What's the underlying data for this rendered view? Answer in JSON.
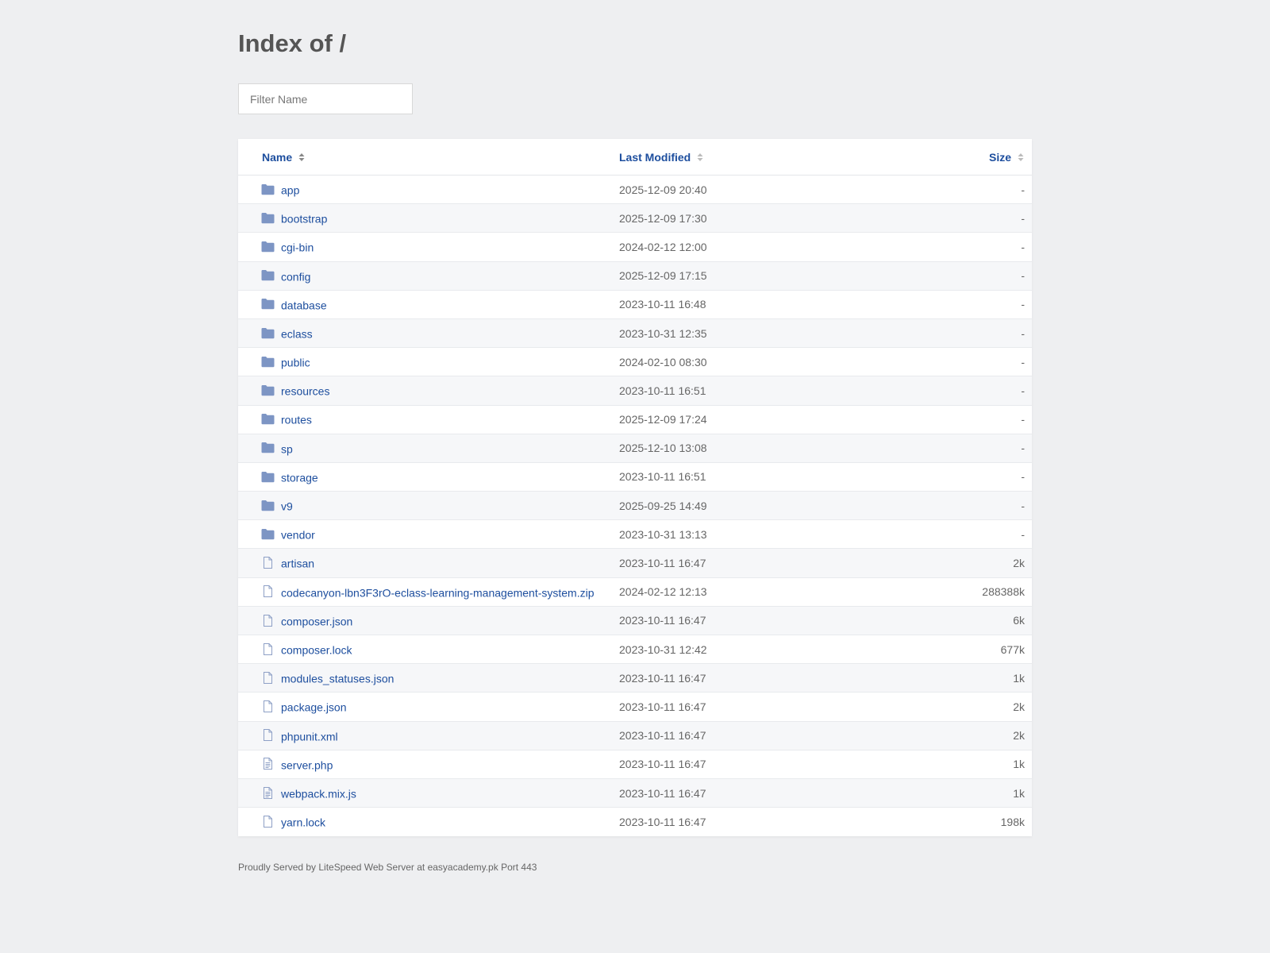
{
  "page": {
    "title": "Index of /",
    "filter_placeholder": "Filter Name",
    "footer": "Proudly Served by LiteSpeed Web Server at easyacademy.pk Port 443"
  },
  "table": {
    "headers": {
      "name": "Name",
      "modified": "Last Modified",
      "size": "Size"
    },
    "rows": [
      {
        "type": "folder-icon",
        "name": "app",
        "modified": "2025-12-09 20:40",
        "size": "-"
      },
      {
        "type": "folder-icon",
        "name": "bootstrap",
        "modified": "2025-12-09 17:30",
        "size": "-"
      },
      {
        "type": "folder-icon",
        "name": "cgi-bin",
        "modified": "2024-02-12 12:00",
        "size": "-"
      },
      {
        "type": "folder-icon",
        "name": "config",
        "modified": "2025-12-09 17:15",
        "size": "-"
      },
      {
        "type": "folder-icon",
        "name": "database",
        "modified": "2023-10-11 16:48",
        "size": "-"
      },
      {
        "type": "folder-icon",
        "name": "eclass",
        "modified": "2023-10-31 12:35",
        "size": "-"
      },
      {
        "type": "folder-icon",
        "name": "public",
        "modified": "2024-02-10 08:30",
        "size": "-"
      },
      {
        "type": "folder-icon",
        "name": "resources",
        "modified": "2023-10-11 16:51",
        "size": "-"
      },
      {
        "type": "folder-icon",
        "name": "routes",
        "modified": "2025-12-09 17:24",
        "size": "-"
      },
      {
        "type": "folder-icon",
        "name": "sp",
        "modified": "2025-12-10 13:08",
        "size": "-"
      },
      {
        "type": "folder-icon",
        "name": "storage",
        "modified": "2023-10-11 16:51",
        "size": "-"
      },
      {
        "type": "folder-icon",
        "name": "v9",
        "modified": "2025-09-25 14:49",
        "size": "-"
      },
      {
        "type": "folder-icon",
        "name": "vendor",
        "modified": "2023-10-31 13:13",
        "size": "-"
      },
      {
        "type": "file-icon",
        "name": "artisan",
        "modified": "2023-10-11 16:47",
        "size": "2k"
      },
      {
        "type": "file-icon",
        "name": "codecanyon-lbn3F3rO-eclass-learning-management-system.zip",
        "modified": "2024-02-12 12:13",
        "size": "288388k"
      },
      {
        "type": "file-icon",
        "name": "composer.json",
        "modified": "2023-10-11 16:47",
        "size": "6k"
      },
      {
        "type": "file-icon",
        "name": "composer.lock",
        "modified": "2023-10-31 12:42",
        "size": "677k"
      },
      {
        "type": "file-icon",
        "name": "modules_statuses.json",
        "modified": "2023-10-11 16:47",
        "size": "1k"
      },
      {
        "type": "file-icon",
        "name": "package.json",
        "modified": "2023-10-11 16:47",
        "size": "2k"
      },
      {
        "type": "file-icon",
        "name": "phpunit.xml",
        "modified": "2023-10-11 16:47",
        "size": "2k"
      },
      {
        "type": "file-text-icon",
        "name": "server.php",
        "modified": "2023-10-11 16:47",
        "size": "1k"
      },
      {
        "type": "file-text-icon",
        "name": "webpack.mix.js",
        "modified": "2023-10-11 16:47",
        "size": "1k"
      },
      {
        "type": "file-icon",
        "name": "yarn.lock",
        "modified": "2023-10-11 16:47",
        "size": "198k"
      }
    ]
  },
  "colors": {
    "background": "#eeeff1",
    "link": "#1d4e9e",
    "icon": "#7d95c4"
  }
}
